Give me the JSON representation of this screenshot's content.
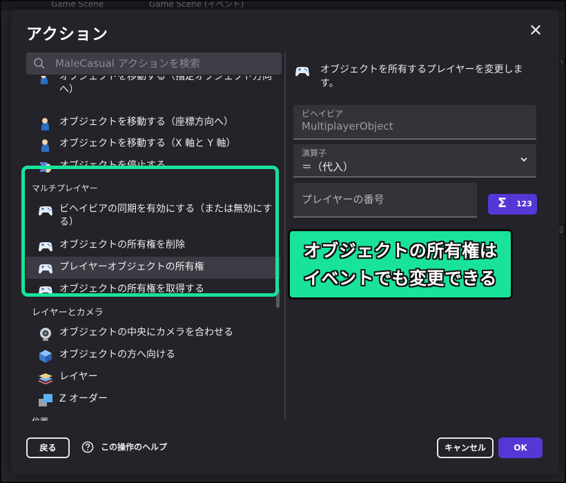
{
  "background": {
    "tabs": [
      "Game Scene",
      "Game Scene (イベント)"
    ],
    "right_labels": [
      "い",
      "加"
    ]
  },
  "dialog": {
    "title": "アクション",
    "close_icon": "close-icon"
  },
  "search": {
    "placeholder": "MaleCasual アクションを検索"
  },
  "list": {
    "items_top": [
      {
        "label": "オブジェクトを移動する（指定オブジェクト方向へ）",
        "icon": "move-object-icon"
      },
      {
        "label": "オブジェクトを移動する（座標方向へ）",
        "icon": "move-object-icon"
      },
      {
        "label": "オブジェクトを移動する（X 軸と Y 軸）",
        "icon": "move-object-icon"
      },
      {
        "label": "オブジェクトを停止する",
        "icon": "stop-object-icon"
      }
    ],
    "multiplayer": {
      "category": "マルチプレイヤー",
      "items": [
        {
          "label": "ビヘイビアの同期を有効にする（または無効にする）",
          "icon": "gamepad-icon"
        },
        {
          "label": "オブジェクトの所有権を削除",
          "icon": "gamepad-icon"
        },
        {
          "label": "プレイヤーオブジェクトの所有権",
          "icon": "gamepad-icon",
          "selected": true
        },
        {
          "label": "オブジェクトの所有権を取得する",
          "icon": "gamepad-icon"
        }
      ]
    },
    "layers": {
      "category": "レイヤーとカメラ",
      "items": [
        {
          "label": "オブジェクトの中央にカメラを合わせる",
          "icon": "camera-icon"
        },
        {
          "label": "オブジェクトの方へ向ける",
          "icon": "cube-icon"
        },
        {
          "label": "レイヤー",
          "icon": "layer-icon"
        },
        {
          "label": "Z オーダー",
          "icon": "z-order-icon"
        }
      ]
    },
    "position_category": "位置"
  },
  "details": {
    "description": "オブジェクトを所有するプレイヤーを変更します。",
    "behavior_label": "ビヘイビア",
    "behavior_value": "MultiplayerObject",
    "operator_label": "演算子",
    "operator_value": "＝（代入）",
    "player_placeholder": "プレイヤーの番号",
    "expression_button": {
      "symbol": "Σ",
      "label": "123"
    }
  },
  "callout": {
    "line1": "オブジェクトの所有権は",
    "line2": "イベントでも変更できる"
  },
  "footer": {
    "back": "戻る",
    "help": "この操作のヘルプ",
    "cancel": "キャンセル",
    "ok": "OK"
  },
  "colors": {
    "accent": "#5537d6",
    "highlight": "#19e39a",
    "dialog_bg": "#232329"
  }
}
